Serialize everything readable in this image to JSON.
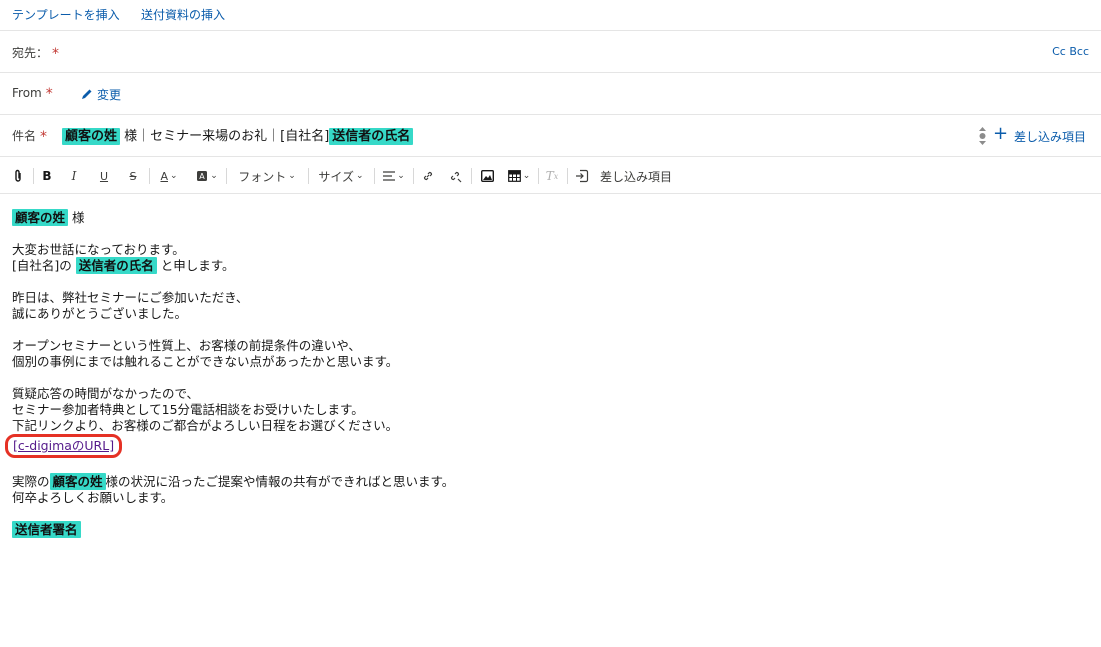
{
  "header": {
    "insert_template": "テンプレートを挿入",
    "insert_attachment": "送付資料の挿入"
  },
  "to_row": {
    "label": "宛先：",
    "cc_bcc": "Cc Bcc"
  },
  "from_row": {
    "label": "From",
    "change_link": "変更"
  },
  "subject_row": {
    "label": "件名",
    "parts": [
      "顧客の姓",
      " 様｜セミナー来場のお礼｜[自社名]",
      "送信者の氏名"
    ],
    "merge_fields_button": "差し込み項目"
  },
  "toolbar": {
    "font_label": "フォント",
    "size_label": "サイズ",
    "merge_fields": "差し込み項目"
  },
  "body": {
    "greeting_merge": "顧客の姓",
    "greeting_suffix": " 様",
    "line_1": "大変お世話になっております。",
    "line_2_prefix": "[自社名]の ",
    "line_2_merge": "送信者の氏名",
    "line_2_suffix": " と申します。",
    "line_3": "昨日は、弊社セミナーにご参加いただき、",
    "line_4": "誠にありがとうございました。",
    "line_5": "オープンセミナーという性質上、お客様の前提条件の違いや、",
    "line_6": "個別の事例にまでは触れることができない点があったかと思います。",
    "line_7": "質疑応答の時間がなかったので、",
    "line_8": "セミナー参加者特典として15分電話相談をお受けいたします。",
    "line_9": "下記リンクより、お客様のご都合がよろしい日程をお選びください。",
    "url_text": "[c-digimaのURL]",
    "line_10_prefix": "実際の",
    "line_10_merge": "顧客の姓",
    "line_10_suffix": "様の状況に沿ったご提案や情報の共有ができればと思います。",
    "line_11": "何卒よろしくお願いします。",
    "signature_merge": "送信者署名"
  },
  "colors": {
    "link": "#0b5cab",
    "merge_highlight": "#36d9c8",
    "required": "#c23934",
    "annotation": "#e53125"
  }
}
